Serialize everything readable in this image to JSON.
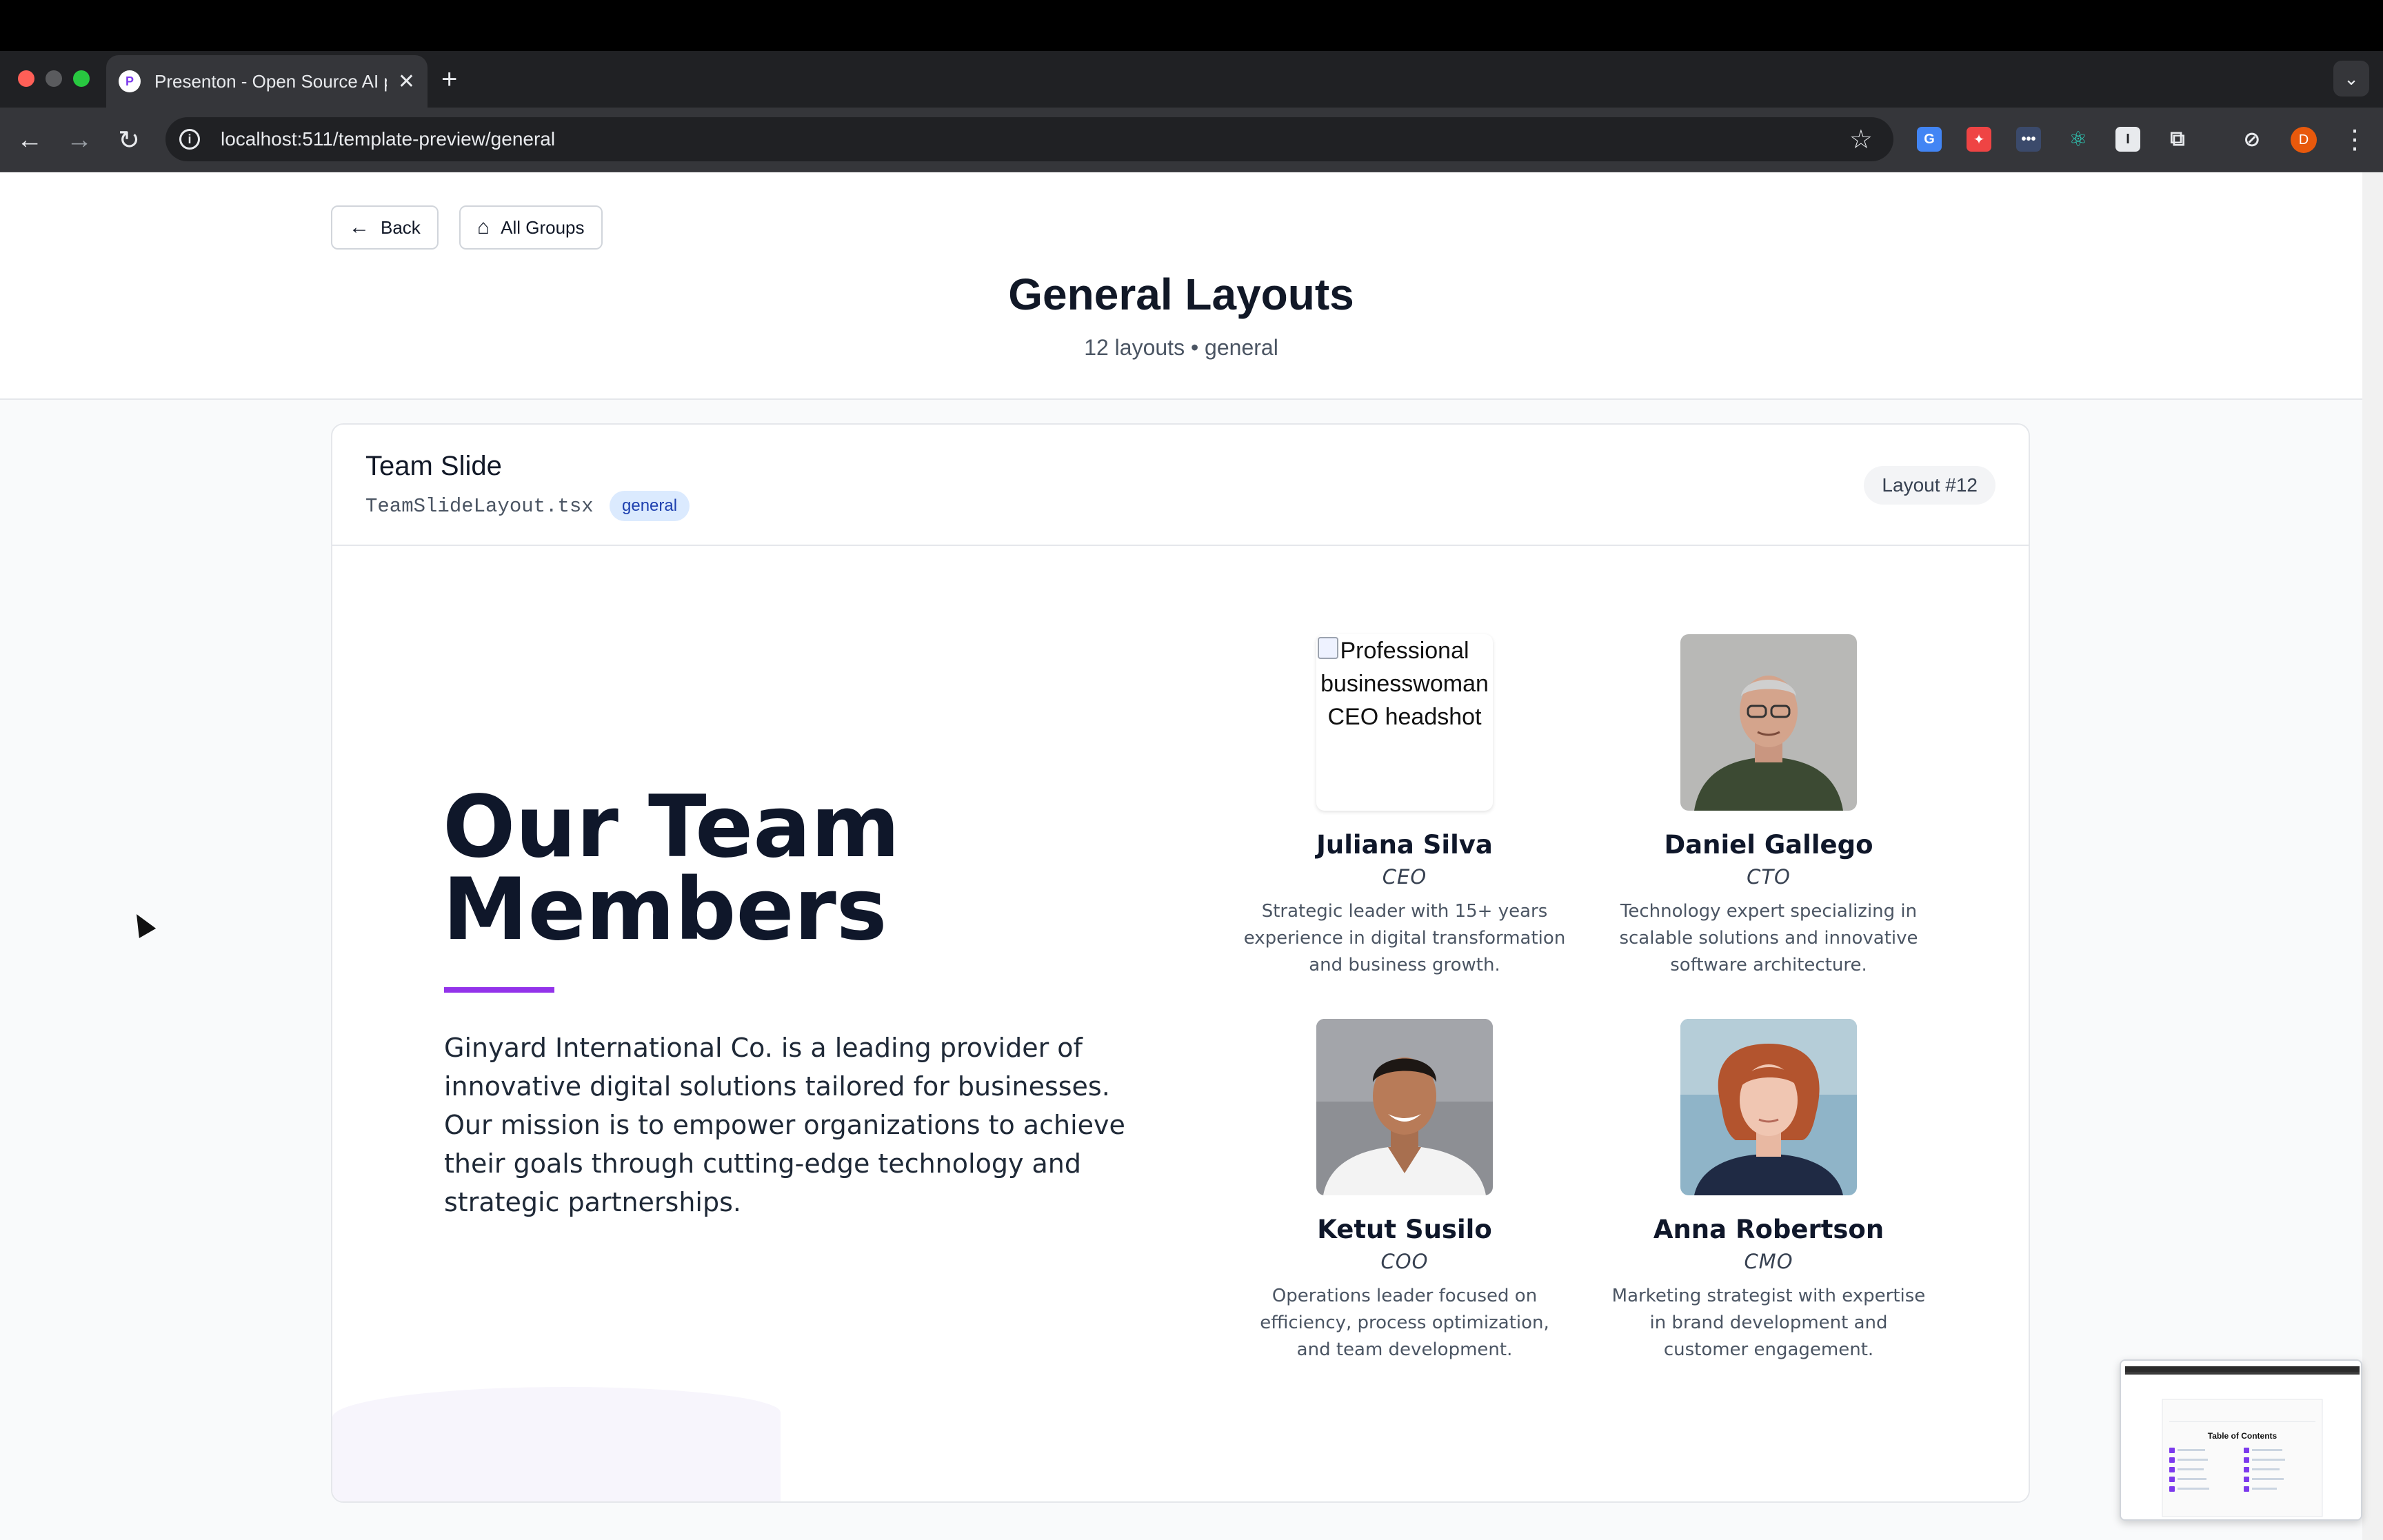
{
  "browser": {
    "tab_title": "Presenton - Open Source AI p",
    "favicon_letter": "P",
    "url": "localhost:511/template-preview/general",
    "profile_initial": "D"
  },
  "header": {
    "back_label": "Back",
    "all_groups_label": "All Groups",
    "title": "General Layouts",
    "subtitle": "12 layouts • general"
  },
  "layout_card": {
    "title": "Team Slide",
    "file": "TeamSlideLayout.tsx",
    "tag": "general",
    "layout_number": "Layout #12"
  },
  "slide": {
    "title": "Our Team Members",
    "description": "Ginyard International Co. is a leading provider of innovative digital solutions tailored for businesses. Our mission is to empower organizations to achieve their goals through cutting-edge technology and strategic partnerships.",
    "accent_color": "#9333ea",
    "members": [
      {
        "name": "Juliana Silva",
        "role": "CEO",
        "description": "Strategic leader with 15+ years experience in digital transformation and business growth.",
        "image_alt": "Professional businesswoman CEO headshot"
      },
      {
        "name": "Daniel Gallego",
        "role": "CTO",
        "description": "Technology expert specializing in scalable solutions and innovative software architecture."
      },
      {
        "name": "Ketut Susilo",
        "role": "COO",
        "description": "Operations leader focused on efficiency, process optimization, and team development."
      },
      {
        "name": "Anna Robertson",
        "role": "CMO",
        "description": "Marketing strategist with expertise in brand development and customer engagement."
      }
    ]
  },
  "thumbnail": {
    "title": "Table of Contents"
  }
}
